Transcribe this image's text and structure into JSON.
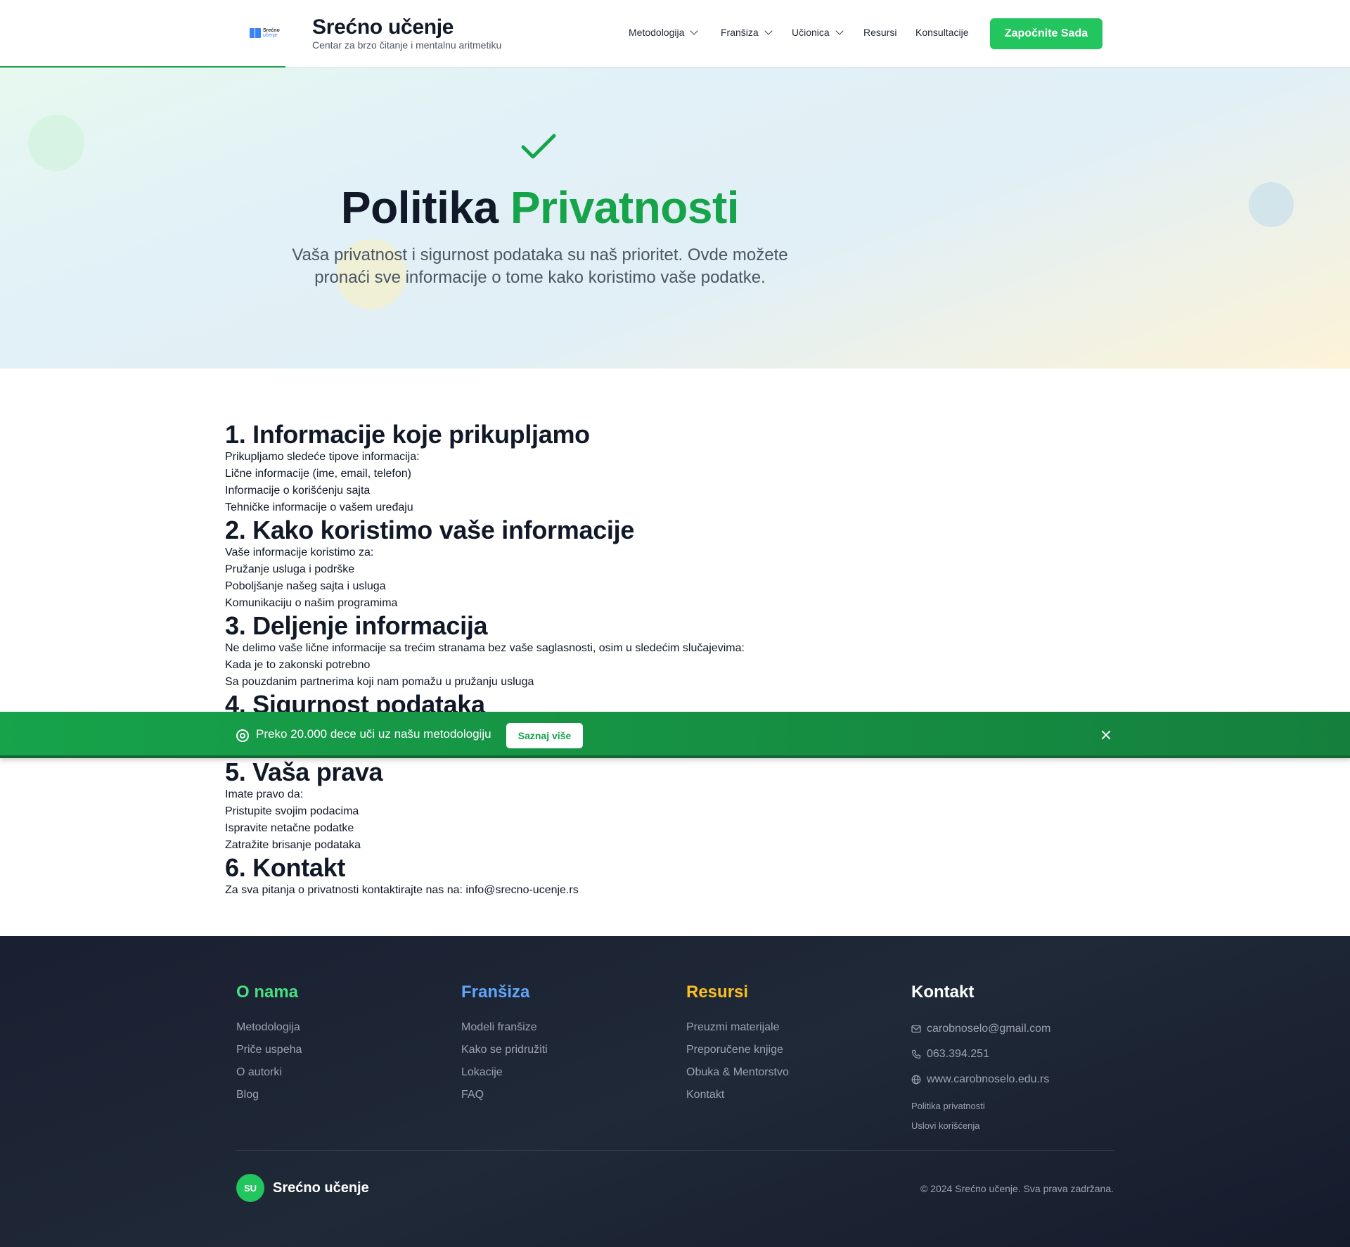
{
  "header": {
    "logo_text": "Srećno",
    "logo_subtext": "učenje",
    "brand_title": "Srećno učenje",
    "brand_subtitle": "Centar za brzo čitanje i mentalnu aritmetiku",
    "nav": [
      {
        "label": "Metodologija",
        "dropdown": true
      },
      {
        "label": "Franšiza",
        "dropdown": true
      },
      {
        "label": "Učionica",
        "dropdown": true
      },
      {
        "label": "Resursi",
        "dropdown": false
      },
      {
        "label": "Konsultacije",
        "dropdown": false
      }
    ],
    "cta_label": "Započnite Sada"
  },
  "hero": {
    "icon": "check-icon",
    "title_part1": "Politika",
    "title_part2": "Privatnosti",
    "description_line1": "Vaša privatnost i sigurnost podataka su naš prioritet. Ovde možete",
    "description_line2": "pronaći sve informacije o tome kako koristimo vaše podatke."
  },
  "sections": [
    {
      "heading": "1. Informacije koje prikupljamo",
      "lines": [
        "Prikupljamo sledeće tipove informacija:",
        "Lične informacije (ime, email, telefon)",
        "Informacije o korišćenju sajta",
        "Tehničke informacije o vašem uređaju"
      ]
    },
    {
      "heading": "2. Kako koristimo vaše informacije",
      "lines": [
        "Vaše informacije koristimo za:",
        "Pružanje usluga i podrške",
        "Poboljšanje našeg sajta i usluga",
        "Komunikaciju o našim programima"
      ]
    },
    {
      "heading": "3. Deljenje informacija",
      "lines": [
        "Ne delimo vaše lične informacije sa trećim stranama bez vaše saglasnosti, osim u sledećim slučajevima:",
        "Kada je to zakonski potrebno",
        "Sa pouzdanim partnerima koji nam pomažu u pružanju usluga"
      ]
    },
    {
      "heading": "4. Sigurnost podataka",
      "lines": []
    },
    {
      "heading": "5. Vaša prava",
      "lines": [
        "Imate pravo da:",
        "Pristupite svojim podacima",
        "Ispravite netačne podatke",
        "Zatražite brisanje podataka"
      ]
    },
    {
      "heading": "6. Kontakt",
      "lines": [
        "Za sva pitanja o privatnosti kontaktirajte nas na: info@srecno-ucenje.rs"
      ]
    }
  ],
  "banner": {
    "icon": "target-icon",
    "text": "Preko 20.000 dece uči uz našu metodologiju",
    "button_label": "Saznaj više",
    "close_icon": "close-icon"
  },
  "footer": {
    "columns": [
      {
        "title": "O nama",
        "color": "#4ade80",
        "links": [
          "Metodologija",
          "Priče uspeha",
          "O autorki",
          "Blog"
        ]
      },
      {
        "title": "Franšiza",
        "color": "#60a5fa",
        "links": [
          "Modeli franšize",
          "Kako se pridružiti",
          "Lokacije",
          "FAQ"
        ]
      },
      {
        "title": "Resursi",
        "color": "#fbbf24",
        "links": [
          "Preuzmi materijale",
          "Preporučene knjige",
          "Obuka & Mentorstvo",
          "Kontakt"
        ]
      }
    ],
    "contact": {
      "title": "Kontakt",
      "email": "carobnoselo@gmail.com",
      "phone": "063.394.251",
      "website": "www.carobnoselo.edu.rs",
      "small_links": [
        "Politika privatnosti",
        "Uslovi korišćenja"
      ]
    },
    "badge": "SU",
    "brand": "Srećno učenje",
    "copyright": "© 2024 Srećno učenje. Sva prava zadržana."
  },
  "colors": {
    "accent": "#16a34a",
    "cta": "#22c55e",
    "footer_bg": "#1f2937"
  }
}
